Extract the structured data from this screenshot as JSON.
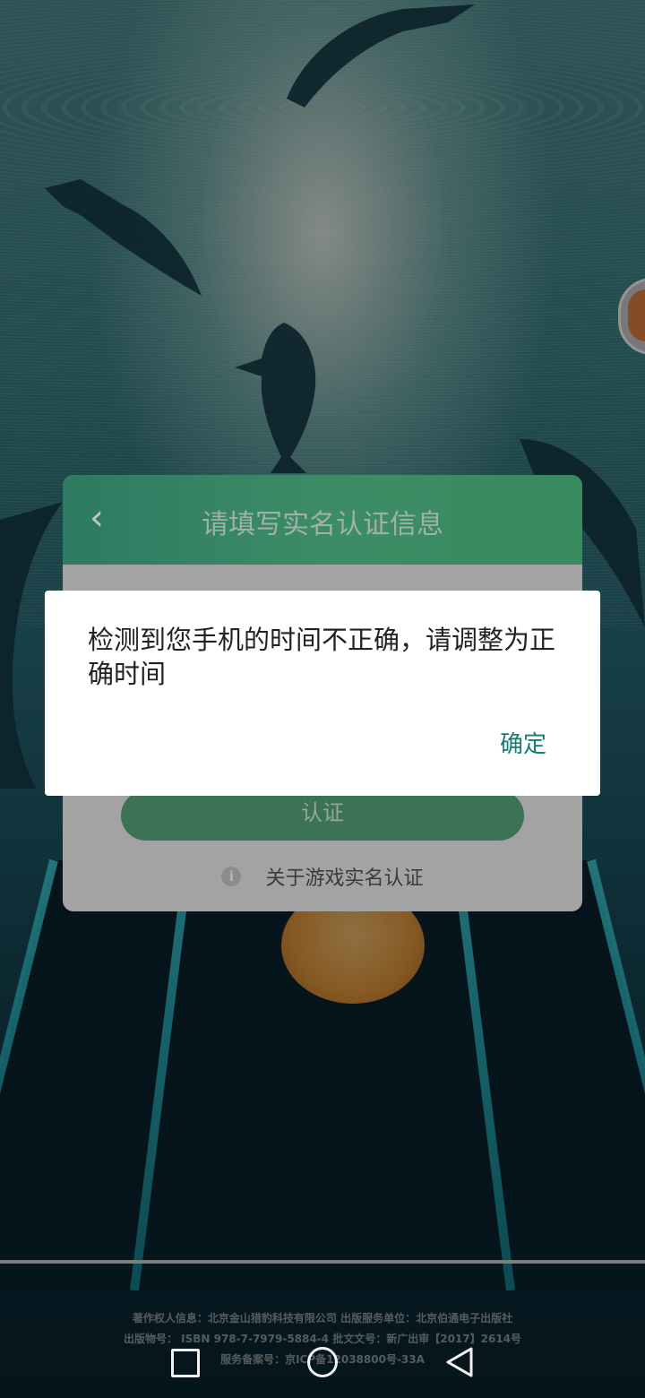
{
  "panel": {
    "title": "请填写实名认证信息",
    "back_glyph": "‹",
    "verify_label": "认证",
    "about_label": "关于游戏实名认证",
    "info_glyph": "i"
  },
  "dialog": {
    "message": "检测到您手机的时间不正确，请调整为正确时间",
    "ok_label": "确定"
  },
  "footer": {
    "line1": "著作权人信息：北京金山猎豹科技有限公司   出版服务单位：北京伯通电子出版社",
    "line2": "出版物号： ISBN 978-7-7979-5884-4  批文文号：新广出审【2017】2614号",
    "line3": "服务备案号：京ICP备12038800号-33A"
  },
  "colors": {
    "accent": "#147d74",
    "panel_header": "#3c8c66",
    "verify_button": "#3d7257"
  },
  "icons": {
    "back": "chevron-left-icon",
    "info": "info-icon",
    "nav_recent": "square-icon",
    "nav_home": "circle-icon",
    "nav_back": "triangle-back-icon"
  }
}
